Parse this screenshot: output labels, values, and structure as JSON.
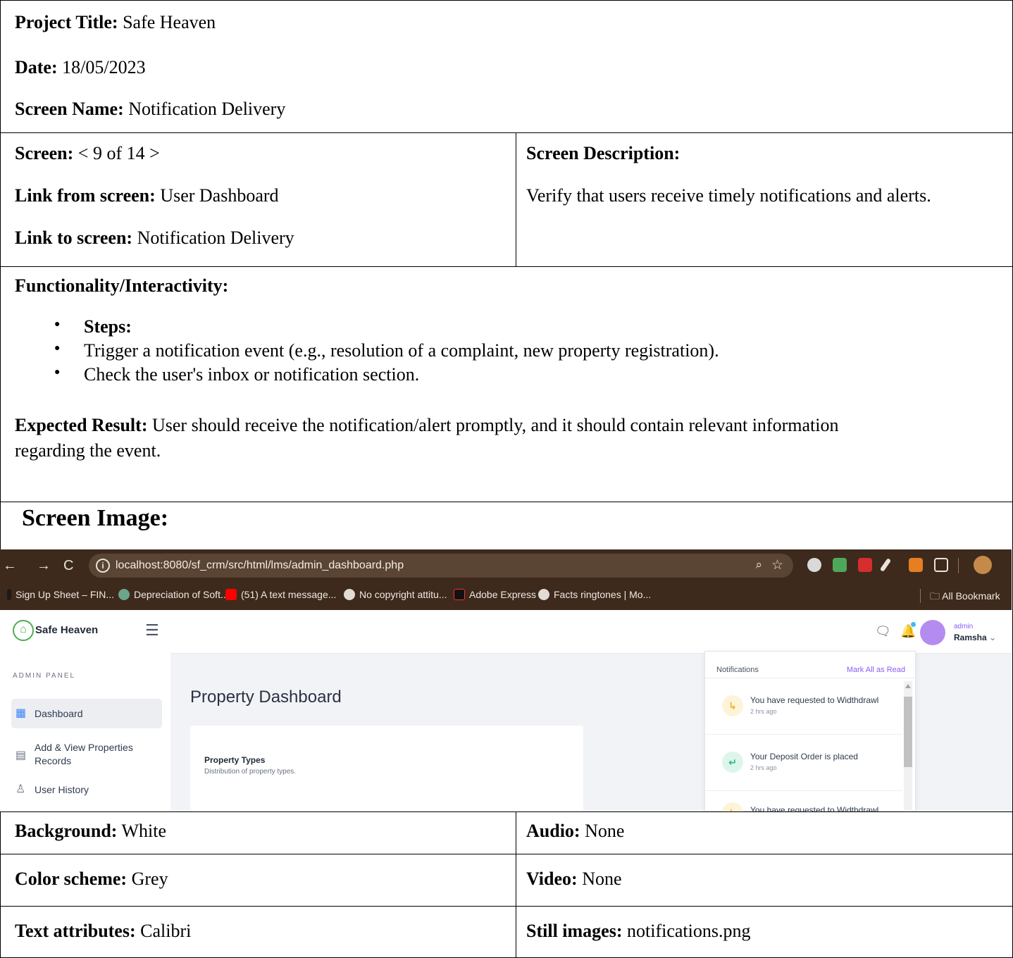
{
  "project": {
    "label": "Project Title:",
    "value": "Safe Heaven"
  },
  "date": {
    "label": "Date:",
    "value": "18/05/2023"
  },
  "screen_name": {
    "label": "Screen Name:",
    "value": "Notification Delivery"
  },
  "screen": {
    "label": "Screen:",
    "value": "< 9 of 14 >"
  },
  "link_from": {
    "label": "Link from screen:",
    "value": "User Dashboard"
  },
  "link_to": {
    "label": "Link to screen:",
    "value": "Notification Delivery"
  },
  "screen_description": {
    "label": "Screen Description:",
    "value": "Verify that users receive timely notifications and alerts."
  },
  "functionality": {
    "label": "Functionality/Interactivity:",
    "steps_label": "Steps:",
    "steps": [
      "Trigger a notification event (e.g., resolution of a complaint, new property registration).",
      "Check the user's inbox or notification section."
    ],
    "expected_label": "Expected Result:",
    "expected_line1": "User should receive the notification/alert promptly, and it should contain relevant information",
    "expected_line2": "regarding the event."
  },
  "screen_image_label": "Screen Image:",
  "screenshot": {
    "url": "localhost:8080/sf_crm/src/html/lms/admin_dashboard.php",
    "bookmarks": [
      "Sign Up Sheet – FIN...",
      "Depreciation of Soft...",
      "(51) A text message...",
      "No copyright attitu...",
      "Adobe Express",
      "Facts ringtones | Mo..."
    ],
    "all_bookmarks": "All Bookmark",
    "brand": "Safe Heaven",
    "panel_label": "ADMIN PANEL",
    "menu": {
      "dashboard": "Dashboard",
      "add_view_1": "Add & View Properties",
      "add_view_2": "Records",
      "user_history": "User History"
    },
    "role": "admin",
    "user": "Ramsha",
    "page_title": "Property Dashboard",
    "card_title": "Property Types",
    "card_subtitle": "Distribution of property types.",
    "notifications": {
      "title": "Notifications",
      "mark_all": "Mark All as Read",
      "items": [
        {
          "text": "You have requested to Widthdrawl",
          "time": "2 hrs ago"
        },
        {
          "text": "Your Deposit Order is placed",
          "time": "2 hrs ago"
        },
        {
          "text": "You have requested to Widthdrawl"
        }
      ]
    },
    "colors": {
      "accent": "#8b5cf6",
      "chrome": "#3d2a1c"
    }
  },
  "background": {
    "label": "Background:",
    "value": "White"
  },
  "audio": {
    "label": "Audio:",
    "value": "None"
  },
  "color_scheme": {
    "label": "Color scheme:",
    "value": "Grey"
  },
  "video": {
    "label": "Video:",
    "value": "None"
  },
  "text_attributes": {
    "label": "Text attributes:",
    "value": "Calibri"
  },
  "still_images": {
    "label": "Still images:",
    "value": "notifications.png"
  }
}
